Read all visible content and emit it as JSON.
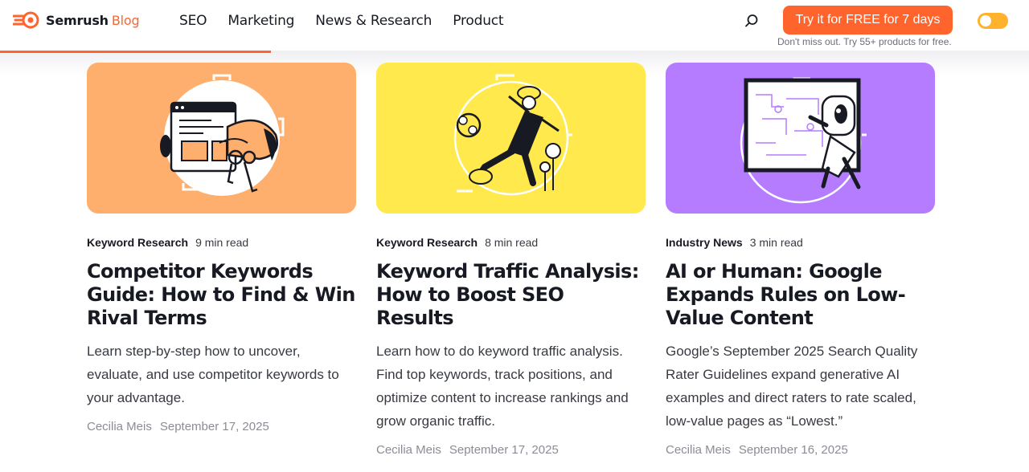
{
  "header": {
    "logo_brand": "Semrush",
    "logo_section": "Blog",
    "nav": [
      "SEO",
      "Marketing",
      "News & Research",
      "Product"
    ],
    "cta_label": "Try it for FREE for 7 days",
    "cta_subtext": "Don't miss out. Try 55+ products for free.",
    "reading_progress": 0.263,
    "colors": {
      "accent": "#ff642d",
      "toggle": "#ffb22c"
    },
    "icons": [
      "semrush-logo-icon",
      "search-icon",
      "theme-toggle"
    ]
  },
  "articles": [
    {
      "category": "Keyword Research",
      "read_time": "9 min read",
      "title": "Competitor Keywords Guide: How to Find & Win Rival Terms",
      "description": "Learn step-by-step how to uncover, evaluate, and use competitor keywords to your advantage.",
      "author": "Cecilia Meis",
      "date": "September 17, 2025",
      "image_bg": "#ffaf6d"
    },
    {
      "category": "Keyword Research",
      "read_time": "8 min read",
      "title": "Keyword Traffic Analysis: How to Boost SEO Results",
      "description": "Learn how to do keyword traffic analysis. Find top keywords, track positions, and optimize content to increase rankings and grow organic traffic.",
      "author": "Cecilia Meis",
      "date": "September 17, 2025",
      "image_bg": "#ffe94d"
    },
    {
      "category": "Industry News",
      "read_time": "3 min read",
      "title": "AI or Human: Google Expands Rules on Low-Value Content",
      "description": "Google’s September 2025 Search Quality Rater Guidelines expand generative AI examples and direct raters to rate scaled, low-value pages as “Lowest.”",
      "author": "Cecilia Meis",
      "date": "September 16, 2025",
      "image_bg": "#b57cff"
    }
  ]
}
